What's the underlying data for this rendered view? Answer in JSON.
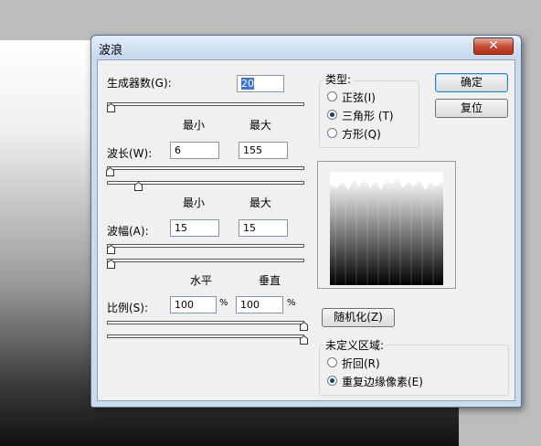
{
  "dialog": {
    "title": "波浪",
    "close_symbol": "✕"
  },
  "generators": {
    "label": "生成器数(G):",
    "value": "20",
    "level": 0.02
  },
  "columns_minmax": {
    "min": "最小",
    "max": "最大"
  },
  "wavelength": {
    "label": "波长(W):",
    "min": "6",
    "max": "155",
    "min_level": 0.01,
    "max_level": 0.155
  },
  "amplitude": {
    "label": "波幅(A):",
    "min": "15",
    "max": "15",
    "min_level": 0.015,
    "max_level": 0.015
  },
  "columns_hv": {
    "horizontal": "水平",
    "vertical": "垂直"
  },
  "scale": {
    "label": "比例(S):",
    "horizontal": "100",
    "vertical": "100",
    "unit": "%",
    "horizontal_level": 1.0,
    "vertical_level": 1.0
  },
  "type_group": {
    "title": "类型:",
    "options": [
      "正弦(I)",
      "三角形 (T)",
      "方形(Q)"
    ],
    "selected": "三角形 (T)"
  },
  "buttons": {
    "ok": "确定",
    "reset": "复位",
    "randomize": "随机化(Z)"
  },
  "undefined_area": {
    "title": "未定义区域:",
    "options": [
      "折回(R)",
      "重复边缘像素(E)"
    ],
    "selected": "重复边缘像素(E)"
  },
  "colors": {
    "accent": "#3875d7",
    "dialog_frame": "#c9dcef",
    "client_bg": "#f0f0f0",
    "close_red": "#c4472f"
  },
  "icons": [
    "close-icon",
    "slider-thumb-icon",
    "radio-icon"
  ]
}
